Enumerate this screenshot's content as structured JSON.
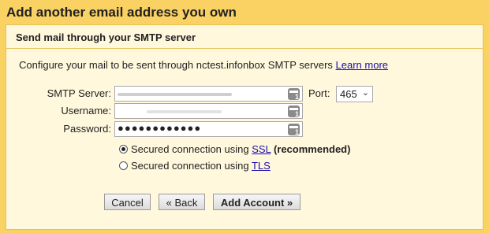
{
  "dialog": {
    "title": "Add another email address you own",
    "subtitle": "Send mail through your SMTP server",
    "description": "Configure your mail to be sent through nctest.infonbox SMTP servers",
    "learn_more": "Learn more"
  },
  "form": {
    "smtp_label": "SMTP Server:",
    "username_label": "Username:",
    "password_label": "Password:",
    "password_value": "●●●●●●●●●●●●",
    "port_label": "Port:",
    "port_value": "465"
  },
  "security": {
    "ssl_prefix": "Secured connection using ",
    "ssl_link": "SSL",
    "ssl_suffix": "(recommended)",
    "tls_prefix": "Secured connection using ",
    "tls_link": "TLS",
    "selected": "ssl"
  },
  "buttons": {
    "cancel": "Cancel",
    "back": "« Back",
    "add": "Add Account »"
  }
}
